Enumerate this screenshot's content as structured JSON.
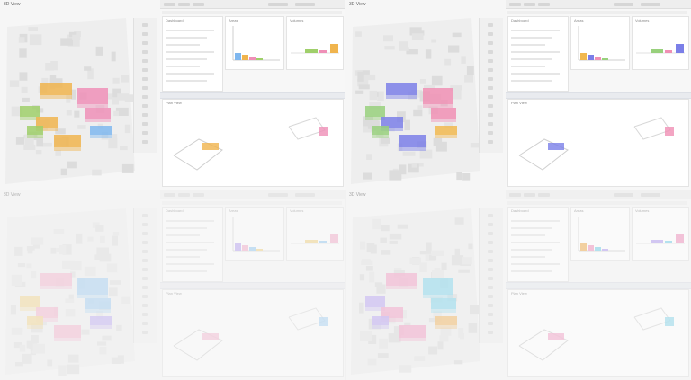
{
  "panels": [
    {
      "id": "top-left",
      "viewport_label": "3D View",
      "dashboard_header": "Dashboard",
      "chart_a_label": "Areas",
      "chart_b_label": "Volumes",
      "lower_view_label": "Plan View",
      "accent": "#f0b44d",
      "secondary": "#ef8fb7",
      "tertiary": "#9fcf6a",
      "quaternary": "#7fb7ef"
    },
    {
      "id": "top-right",
      "viewport_label": "3D View",
      "dashboard_header": "Dashboard",
      "chart_a_label": "Areas",
      "chart_b_label": "Volumes",
      "lower_view_label": "Plan View",
      "accent": "#7b7fe8",
      "secondary": "#f08fb4",
      "tertiary": "#98d07c",
      "quaternary": "#f1b84f"
    },
    {
      "id": "bottom-left",
      "viewport_label": "3D View",
      "dashboard_header": "Dashboard",
      "chart_a_label": "Areas",
      "chart_b_label": "Volumes",
      "lower_view_label": "Plan View",
      "accent": "#f3a7c6",
      "secondary": "#8fc6f1",
      "tertiary": "#f1d07b",
      "quaternary": "#b39cf0"
    },
    {
      "id": "bottom-right",
      "viewport_label": "3D View",
      "dashboard_header": "Dashboard",
      "chart_a_label": "Areas",
      "chart_b_label": "Volumes",
      "lower_view_label": "Plan View",
      "accent": "#f29bc2",
      "secondary": "#7ed3ea",
      "tertiary": "#b8a3f2",
      "quaternary": "#f1b45d"
    }
  ]
}
